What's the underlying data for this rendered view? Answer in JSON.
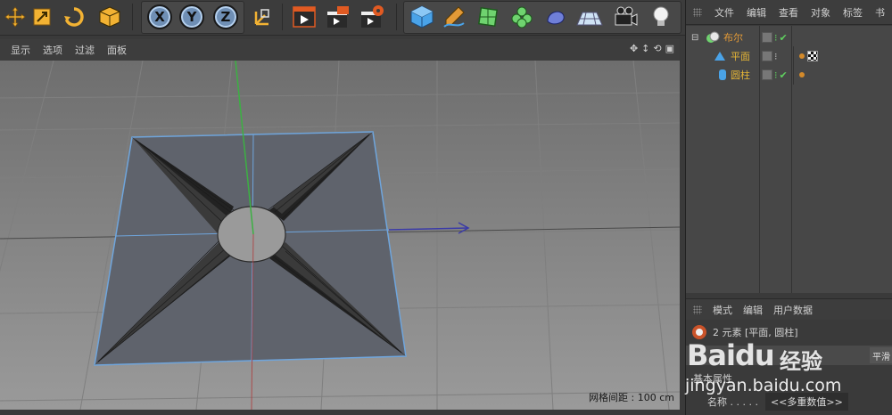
{
  "viewport_menu": {
    "items": [
      "显示",
      "选项",
      "过滤",
      "面板"
    ]
  },
  "toolbar": {
    "axis_x": "X",
    "axis_y": "Y",
    "axis_z": "Z"
  },
  "objects_panel": {
    "menu": [
      "文件",
      "编辑",
      "查看",
      "对象",
      "标签",
      "书"
    ],
    "items": [
      {
        "name": "布尔",
        "color": "#e39a37"
      },
      {
        "name": "平面",
        "color": "#e3b437"
      },
      {
        "name": "圆柱",
        "color": "#e3b437"
      }
    ]
  },
  "attributes_panel": {
    "menu": [
      "模式",
      "编辑",
      "用户数据"
    ],
    "selection_text": "2 元素 [平面, 圆柱]",
    "section": "基本属性",
    "name_label": "名称 . . . . .",
    "name_value": "<<多重数值>>",
    "side_button": "平滑"
  },
  "viewport": {
    "grid_spacing": "网格间距 : 100 cm"
  },
  "watermark": {
    "logo": "Baidu",
    "word": "经验",
    "url": "jingyan.baidu.com"
  },
  "colors": {
    "accent_orange": "#e39a37",
    "axis_y": "#3cb043",
    "axis_x": "#3a3aa8",
    "axis_z": "#b03a3a",
    "selection_outline": "#6fa5dc"
  }
}
